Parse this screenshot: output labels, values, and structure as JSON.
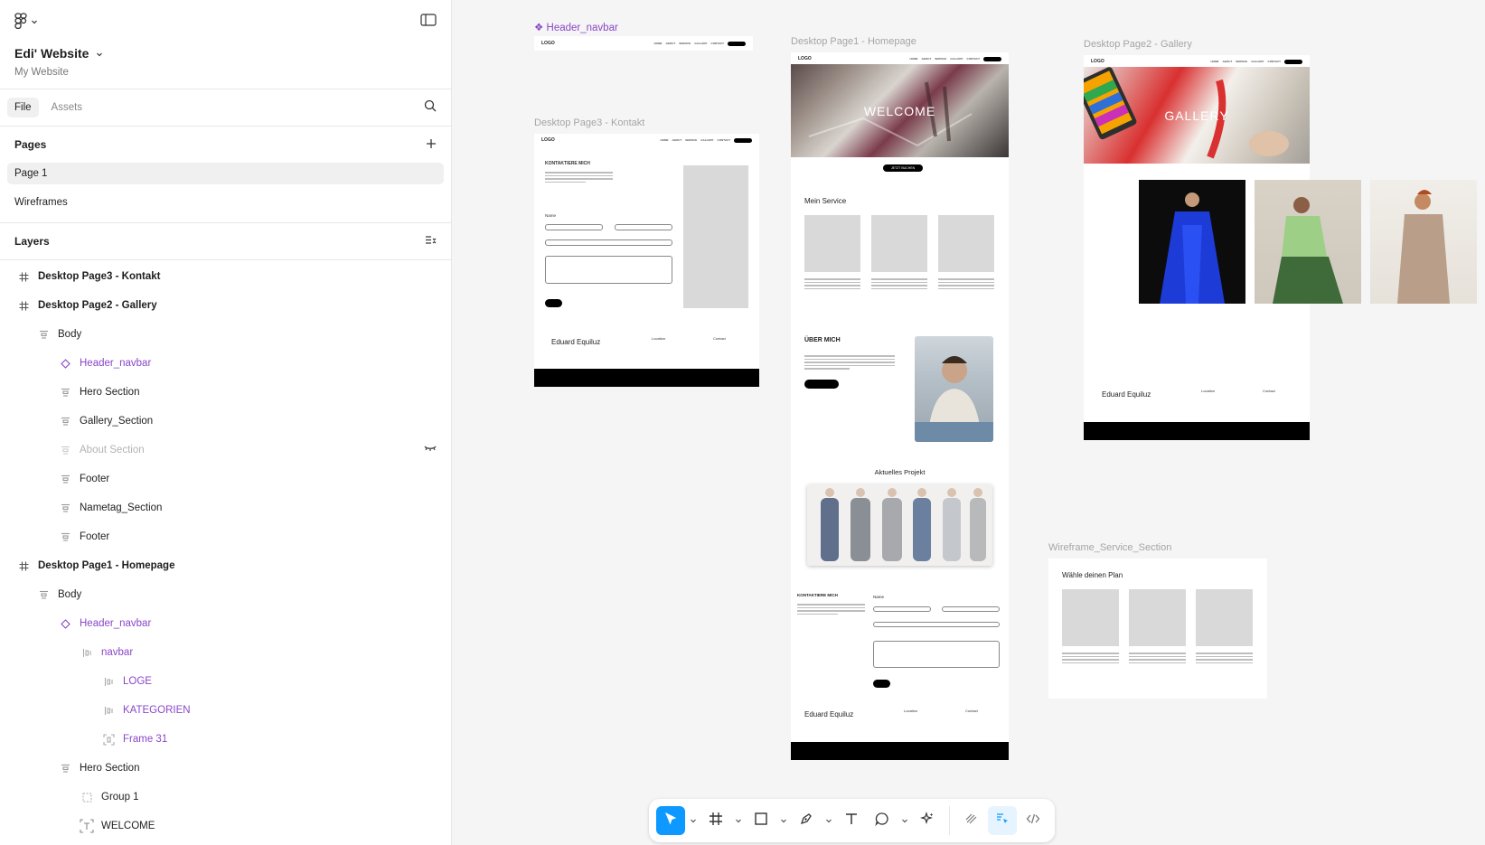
{
  "header": {
    "project_name": "Edi' Website",
    "project_sub": "My Website"
  },
  "tabs": {
    "file": "File",
    "assets": "Assets"
  },
  "pages": {
    "title": "Pages",
    "items": [
      "Page 1",
      "Wireframes"
    ]
  },
  "layers": {
    "title": "Layers",
    "items": [
      {
        "label": "Desktop Page3 - Kontakt"
      },
      {
        "label": "Desktop Page2 - Gallery"
      },
      {
        "label": "Body"
      },
      {
        "label": "Header_navbar"
      },
      {
        "label": "Hero Section"
      },
      {
        "label": "Gallery_Section"
      },
      {
        "label": "About Section"
      },
      {
        "label": "Footer"
      },
      {
        "label": "Nametag_Section"
      },
      {
        "label": "Footer"
      },
      {
        "label": "Desktop Page1 - Homepage"
      },
      {
        "label": "Body"
      },
      {
        "label": "Header_navbar"
      },
      {
        "label": "navbar"
      },
      {
        "label": "LOGE"
      },
      {
        "label": "KATEGORIEN"
      },
      {
        "label": "Frame 31"
      },
      {
        "label": "Hero Section"
      },
      {
        "label": "Group 1"
      },
      {
        "label": "WELCOME"
      }
    ]
  },
  "canvas": {
    "frames": {
      "header_navbar": "Header_navbar",
      "page3": "Desktop Page3 - Kontakt",
      "page1": "Desktop Page1 - Homepage",
      "page2": "Desktop Page2 - Gallery",
      "wireframe": "Wireframe_Service_Section"
    },
    "content": {
      "logo": "LOGO",
      "kontaktiere": "KONTAKTIERE MICH",
      "name_label": "Name",
      "eduard": "Eduard Equiluz",
      "contact": "Contact",
      "location": "Location",
      "welcome": "WELCOME",
      "jetzt_buchen": "JETZT BUCHEN",
      "mein_service": "Mein Service",
      "ueber_mich": "ÜBER MICH",
      "aktuelles_projekt": "Aktuelles Projekt",
      "gallery": "GALLERY",
      "waehle_plan": "Wähle deinen Plan"
    }
  }
}
